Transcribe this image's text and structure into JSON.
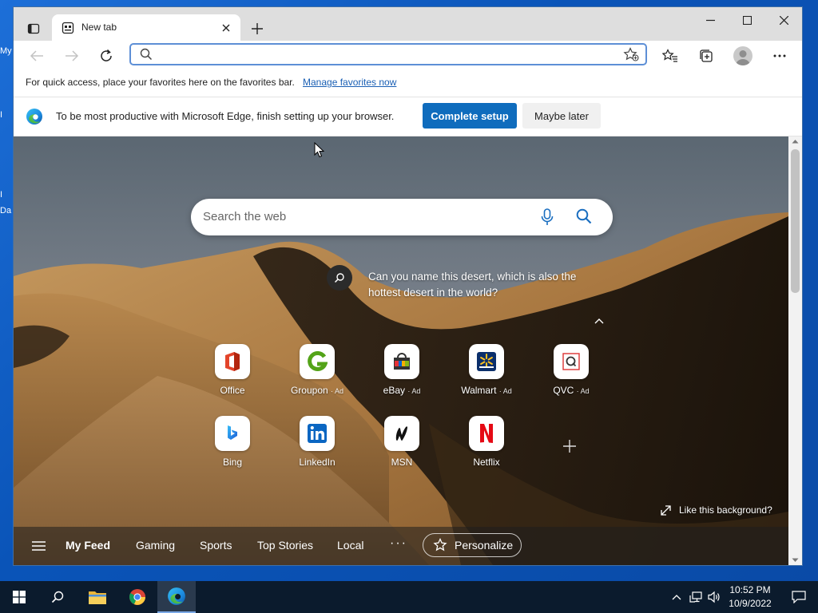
{
  "desktop": {
    "labels": [
      "My",
      "I",
      "I",
      "Da"
    ]
  },
  "browser": {
    "tab": {
      "title": "New tab"
    },
    "address": {
      "value": "",
      "placeholder": ""
    },
    "favbar": {
      "text": "For quick access, place your favorites here on the favorites bar.",
      "link": "Manage favorites now"
    },
    "infobar": {
      "text": "To be most productive with Microsoft Edge, finish setting up your browser.",
      "primary": "Complete setup",
      "secondary": "Maybe later"
    }
  },
  "ntp": {
    "search_placeholder": "Search the web",
    "fact": "Can you name this desert, which is also the hottest desert in the world?",
    "tiles": [
      {
        "label": "Office",
        "ad": "",
        "icon": "office-icon"
      },
      {
        "label": "Groupon",
        "ad": "· Ad",
        "icon": "groupon-icon"
      },
      {
        "label": "eBay",
        "ad": "· Ad",
        "icon": "ebay-icon"
      },
      {
        "label": "Walmart",
        "ad": "· Ad",
        "icon": "walmart-icon"
      },
      {
        "label": "QVC",
        "ad": "· Ad",
        "icon": "qvc-icon"
      },
      {
        "label": "Bing",
        "ad": "",
        "icon": "bing-icon"
      },
      {
        "label": "LinkedIn",
        "ad": "",
        "icon": "linkedin-icon"
      },
      {
        "label": "MSN",
        "ad": "",
        "icon": "msn-icon"
      },
      {
        "label": "Netflix",
        "ad": "",
        "icon": "netflix-icon"
      }
    ],
    "like_background": "Like this background?",
    "feed": {
      "items": [
        "My Feed",
        "Gaming",
        "Sports",
        "Top Stories",
        "Local"
      ],
      "more": "···",
      "personalize": "Personalize"
    }
  },
  "taskbar": {
    "time": "10:52 PM",
    "date": "10/9/2022"
  },
  "colors": {
    "accent": "#0f6cbd",
    "taskbar": "#0b1b2d"
  }
}
